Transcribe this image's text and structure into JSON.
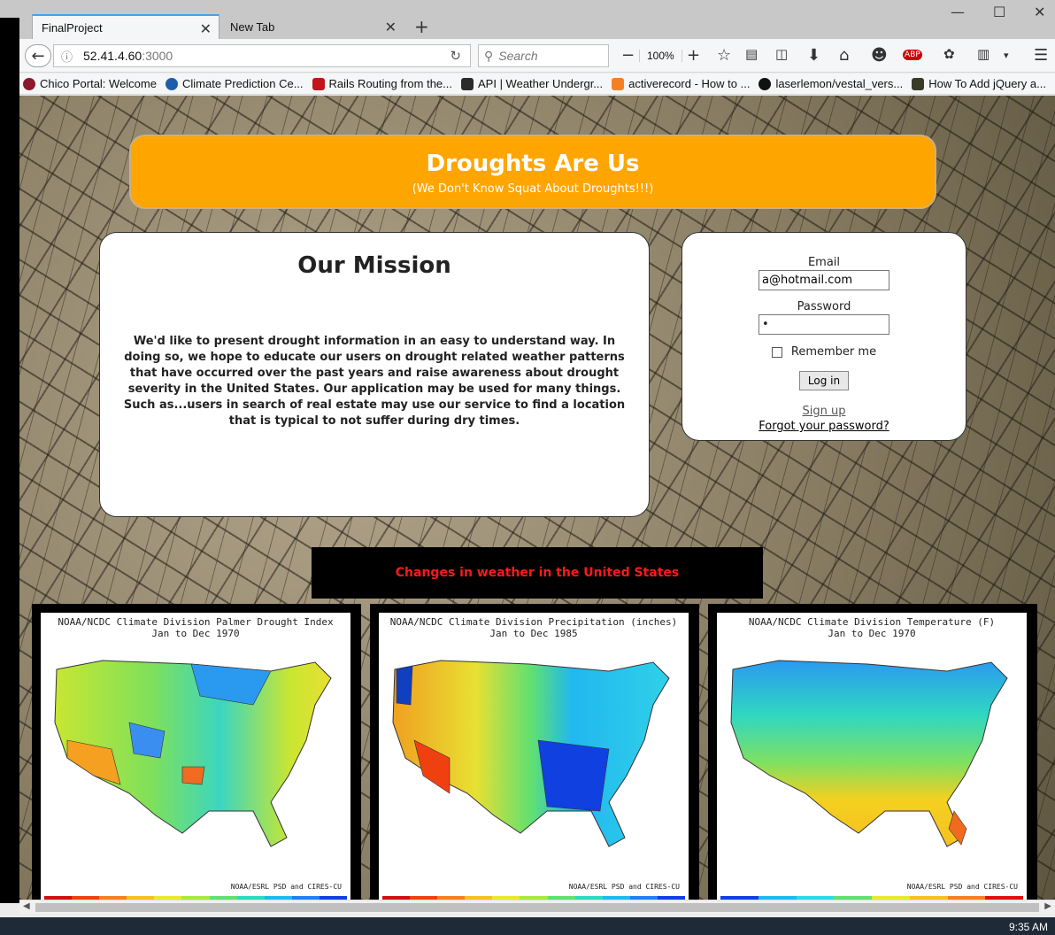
{
  "browser": {
    "tabs": [
      {
        "label": "FinalProject",
        "active": true
      },
      {
        "label": "New Tab",
        "active": false
      }
    ],
    "url_host": "52.41.4.60",
    "url_port": ":3000",
    "search_placeholder": "Search",
    "zoom": "100%",
    "bookmarks": [
      {
        "label": "Chico Portal: Welcome",
        "color": "#8b1a2b"
      },
      {
        "label": "Climate Prediction Ce...",
        "color": "#1f5fa8"
      },
      {
        "label": "Rails Routing from the...",
        "color": "#c0161b"
      },
      {
        "label": "API | Weather Undergr...",
        "color": "#2b2b2b"
      },
      {
        "label": "activerecord - How to ...",
        "color": "#f48024"
      },
      {
        "label": "laserlemon/vestal_vers...",
        "color": "#111111"
      },
      {
        "label": "How To Add jQuery a...",
        "color": "#3a3a2a"
      }
    ]
  },
  "page": {
    "header_title": "Droughts Are Us",
    "header_subtitle": "(We Don't Know Squat About Droughts!!!)",
    "mission_title": "Our Mission",
    "mission_text": "We'd like to present drought information in an easy to understand way. In doing so, we hope to educate our users on drought related weather patterns that have occurred over the past years and raise awareness about drought severity in the United States. Our application may be used for many things. Such as...users in search of real estate may use our service to find a location that is typical to not suffer during dry times.",
    "login": {
      "email_label": "Email",
      "email_value": "a@hotmail.com",
      "password_label": "Password",
      "password_value": "•",
      "remember_label": "Remember me",
      "login_button": "Log in",
      "signup_link": "Sign up",
      "forgot_link": "Forgot your password?"
    },
    "changes_banner": "Changes in weather in the United States",
    "maps": [
      {
        "title1": "NOAA/NCDC Climate Division Palmer Drought Index",
        "title2": "Jan to Dec 1970",
        "credit": "NOAA/ESRL PSD and CIRES-CU"
      },
      {
        "title1": "NOAA/NCDC Climate Division Precipitation (inches)",
        "title2": "Jan to Dec 1985",
        "credit": "NOAA/ESRL PSD and CIRES-CU"
      },
      {
        "title1": "NOAA/NCDC Climate Division Temperature (F)",
        "title2": "Jan to Dec 1970",
        "credit": "NOAA/ESRL PSD and CIRES-CU"
      }
    ]
  },
  "taskbar": {
    "clock": "9:35 AM"
  }
}
